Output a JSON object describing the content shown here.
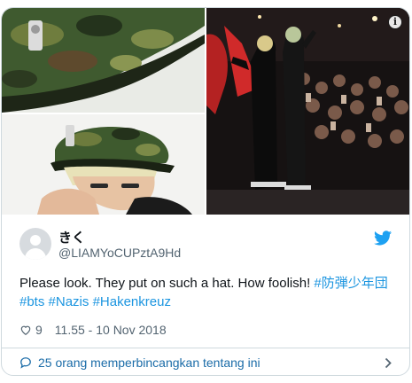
{
  "tweet": {
    "user": {
      "name": "きく",
      "handle": "@LIAMYoCUPztA9Hd"
    },
    "text": {
      "plain": "Please look. They put on such a hat. How foolish! ",
      "hashtags": [
        "#防弾少年団",
        "#bts",
        "#Nazis",
        "#Hakenkreuz"
      ]
    },
    "like_count": "9",
    "timestamp": "11.55 - 10 Nov 2018"
  },
  "conversation": {
    "label": "25 orang memperbincangkan tentang ini"
  },
  "icons": {
    "info": "info-icon",
    "brand": "twitter-bird-icon",
    "like": "heart-icon",
    "conversation": "speech-bubble-icon",
    "open": "chevron-right-icon"
  },
  "colors": {
    "hashtag": "#1b95e0",
    "twitter_blue": "#1da1f2",
    "secondary_text": "#536471",
    "link": "#1b6ca8"
  }
}
